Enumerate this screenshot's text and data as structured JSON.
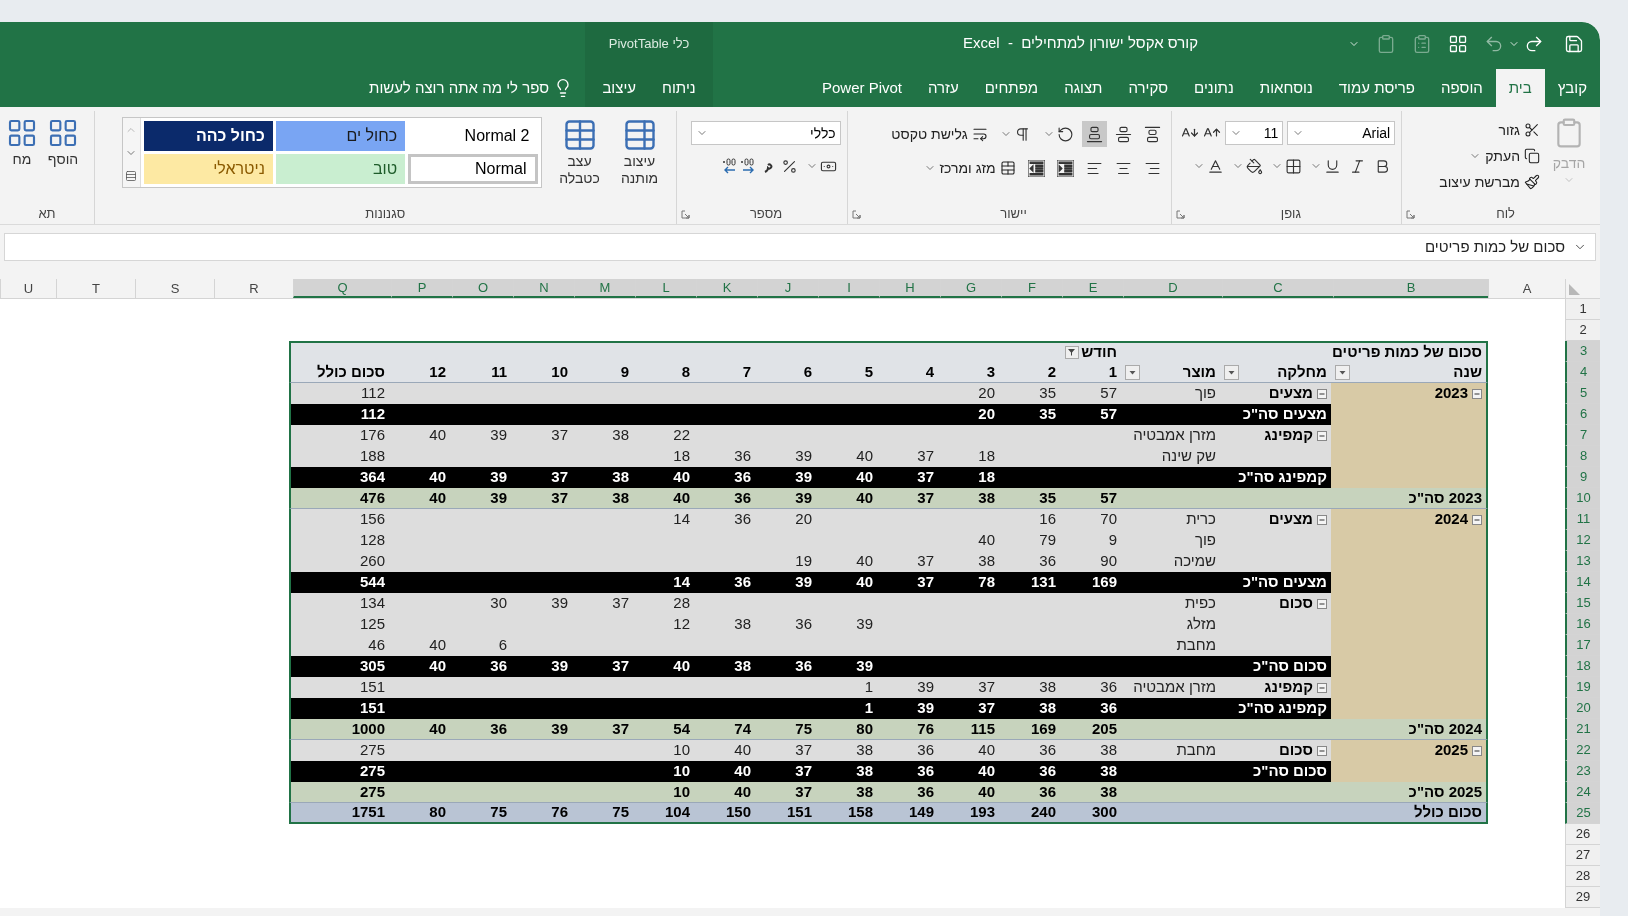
{
  "window": {
    "title": "קורס אקסל ישורון למתחילים  -  Excel"
  },
  "contextual_group": {
    "label": "כלי PivotTable"
  },
  "tabs": [
    {
      "label": "קובץ",
      "kind": "main",
      "selected": false
    },
    {
      "label": "בית",
      "kind": "main",
      "selected": true
    },
    {
      "label": "הוספה",
      "kind": "main",
      "selected": false
    },
    {
      "label": "פריסת עמוד",
      "kind": "main",
      "selected": false
    },
    {
      "label": "נוסחאות",
      "kind": "main",
      "selected": false
    },
    {
      "label": "נתונים",
      "kind": "main",
      "selected": false
    },
    {
      "label": "סקירה",
      "kind": "main",
      "selected": false
    },
    {
      "label": "תצוגה",
      "kind": "main",
      "selected": false
    },
    {
      "label": "מפתחים",
      "kind": "main",
      "selected": false
    },
    {
      "label": "עזרה",
      "kind": "main",
      "selected": false
    },
    {
      "label": "Power Pivot",
      "kind": "main",
      "selected": false
    },
    {
      "label": "ניתוח",
      "kind": "contextual",
      "selected": false
    },
    {
      "label": "עיצוב",
      "kind": "contextual",
      "selected": false
    }
  ],
  "tell_me": {
    "label": "ספר לי מה אתה רוצה לעשות"
  },
  "ribbon": {
    "clipboard": {
      "label": "לוח",
      "paste": {
        "label": "הדבק",
        "disabled": true
      },
      "cut": "גזור",
      "copy": "העתק",
      "format_painter": "מברשת עיצוב"
    },
    "font": {
      "label": "גופן",
      "font_name": "Arial",
      "font_size": "11"
    },
    "alignment": {
      "label": "יישור",
      "wrap_text": "גלישת טקסט",
      "merge": "מזג ומרכז",
      "vertical": [
        {
          "kind": "top",
          "selected": false
        },
        {
          "kind": "middle",
          "selected": false
        },
        {
          "kind": "bottom",
          "selected": true
        }
      ]
    },
    "number": {
      "label": "מספר",
      "format": "כללי"
    },
    "styles": {
      "label": "סגנונות",
      "conditional_formatting": "עיצוב מותנה",
      "format_as_table": "עצב כטבלה",
      "gallery": [
        {
          "label": "Normal 2",
          "kind": "plain",
          "selected": false
        },
        {
          "label": "כחול ים",
          "kind": "accent",
          "selected": false
        },
        {
          "label": "כחול כהה",
          "kind": "dark",
          "selected": false
        },
        {
          "label": "Normal",
          "kind": "plain",
          "selected": true
        },
        {
          "label": "טוב",
          "kind": "good",
          "selected": false
        },
        {
          "label": "ניטראלי",
          "kind": "neutral",
          "selected": false
        }
      ]
    },
    "cells": {
      "label": "תא",
      "insert": "הוסף",
      "delete": "מח"
    }
  },
  "formula_bar": {
    "value": "סכום של כמות פריטים"
  },
  "sheet": {
    "columns": [
      {
        "letter": "A",
        "selected": false
      },
      {
        "letter": "B",
        "selected": true
      },
      {
        "letter": "C",
        "selected": true
      },
      {
        "letter": "D",
        "selected": true
      },
      {
        "letter": "E",
        "selected": true
      },
      {
        "letter": "F",
        "selected": true
      },
      {
        "letter": "G",
        "selected": true
      },
      {
        "letter": "H",
        "selected": true
      },
      {
        "letter": "I",
        "selected": true
      },
      {
        "letter": "J",
        "selected": true
      },
      {
        "letter": "K",
        "selected": true
      },
      {
        "letter": "L",
        "selected": true
      },
      {
        "letter": "M",
        "selected": true
      },
      {
        "letter": "N",
        "selected": true
      },
      {
        "letter": "O",
        "selected": true
      },
      {
        "letter": "P",
        "selected": true
      },
      {
        "letter": "Q",
        "selected": true
      },
      {
        "letter": "R",
        "selected": false
      },
      {
        "letter": "S",
        "selected": false
      },
      {
        "letter": "T",
        "selected": false
      },
      {
        "letter": "U",
        "selected": false
      }
    ],
    "rows": [
      {
        "number": "1",
        "selected": false
      },
      {
        "number": "2",
        "selected": false
      },
      {
        "number": "3",
        "selected": true,
        "kind": "header_title",
        "title": "סכום של כמות פריטים",
        "column_field": {
          "text": "חודש",
          "filtered": true
        }
      },
      {
        "number": "4",
        "selected": true,
        "kind": "header",
        "year": {
          "text": "שנה",
          "dropdown": true
        },
        "category": {
          "text": "מחלקה",
          "dropdown": true
        },
        "product": {
          "text": "מוצר",
          "dropdown": true
        },
        "values": {
          "m1": "1",
          "m2": "2",
          "m3": "3",
          "m4": "4",
          "m5": "5",
          "m6": "6",
          "m7": "7",
          "m8": "8",
          "m9": "9",
          "m10": "10",
          "m11": "11",
          "m12": "12"
        },
        "total": "סכום כולל"
      },
      {
        "number": "5",
        "selected": true,
        "kind": "data",
        "year": {
          "text": "2023",
          "expanded": true
        },
        "category": {
          "text": "מצעים",
          "expanded": true
        },
        "product": "פוך",
        "values": {
          "m1": "57",
          "m2": "35",
          "m3": "20"
        },
        "total": "112"
      },
      {
        "number": "6",
        "selected": true,
        "kind": "subtotal",
        "label": "מצעים סה\"כ",
        "values": {
          "m1": "57",
          "m2": "35",
          "m3": "20"
        },
        "total": "112"
      },
      {
        "number": "7",
        "selected": true,
        "kind": "data",
        "category": {
          "text": "קמפינג",
          "expanded": true
        },
        "product": "מזרן אמבטיה",
        "values": {
          "m8": "22",
          "m9": "38",
          "m10": "37",
          "m11": "39",
          "m12": "40"
        },
        "total": "176"
      },
      {
        "number": "8",
        "selected": true,
        "kind": "data",
        "product": "שק שינה",
        "values": {
          "m3": "18",
          "m4": "37",
          "m5": "40",
          "m6": "39",
          "m7": "36",
          "m8": "18"
        },
        "total": "188"
      },
      {
        "number": "9",
        "selected": true,
        "kind": "subtotal",
        "label": "קמפינג סה\"כ",
        "values": {
          "m3": "18",
          "m4": "37",
          "m5": "40",
          "m6": "39",
          "m7": "36",
          "m8": "40",
          "m9": "38",
          "m10": "37",
          "m11": "39",
          "m12": "40"
        },
        "total": "364"
      },
      {
        "number": "10",
        "selected": true,
        "kind": "year_total",
        "label": "2023 סה\"כ",
        "values": {
          "m1": "57",
          "m2": "35",
          "m3": "38",
          "m4": "37",
          "m5": "40",
          "m6": "39",
          "m7": "36",
          "m8": "40",
          "m9": "38",
          "m10": "37",
          "m11": "39",
          "m12": "40"
        },
        "total": "476"
      },
      {
        "number": "11",
        "selected": true,
        "kind": "data",
        "year": {
          "text": "2024",
          "expanded": true
        },
        "category": {
          "text": "מצעים",
          "expanded": true
        },
        "product": "כרית",
        "values": {
          "m1": "70",
          "m2": "16",
          "m6": "20",
          "m7": "36",
          "m8": "14"
        },
        "total": "156"
      },
      {
        "number": "12",
        "selected": true,
        "kind": "data",
        "product": "פוך",
        "values": {
          "m1": "9",
          "m2": "79",
          "m3": "40"
        },
        "total": "128"
      },
      {
        "number": "13",
        "selected": true,
        "kind": "data",
        "product": "שמיכה",
        "values": {
          "m1": "90",
          "m2": "36",
          "m3": "38",
          "m4": "37",
          "m5": "40",
          "m6": "19"
        },
        "total": "260"
      },
      {
        "number": "14",
        "selected": true,
        "kind": "subtotal",
        "label": "מצעים סה\"כ",
        "values": {
          "m1": "169",
          "m2": "131",
          "m3": "78",
          "m4": "37",
          "m5": "40",
          "m6": "39",
          "m7": "36",
          "m8": "14"
        },
        "total": "544"
      },
      {
        "number": "15",
        "selected": true,
        "kind": "data",
        "category": {
          "text": "סכום",
          "expanded": true
        },
        "product": "כפית",
        "values": {
          "m8": "28",
          "m9": "37",
          "m10": "39",
          "m11": "30"
        },
        "total": "134"
      },
      {
        "number": "16",
        "selected": true,
        "kind": "data",
        "product": "מזלג",
        "values": {
          "m5": "39",
          "m6": "36",
          "m7": "38",
          "m8": "12"
        },
        "total": "125"
      },
      {
        "number": "17",
        "selected": true,
        "kind": "data",
        "product": "מחבת",
        "values": {
          "m11": "6",
          "m12": "40"
        },
        "total": "46"
      },
      {
        "number": "18",
        "selected": true,
        "kind": "subtotal",
        "label": "סכום סה\"כ",
        "values": {
          "m5": "39",
          "m6": "36",
          "m7": "38",
          "m8": "40",
          "m9": "37",
          "m10": "39",
          "m11": "36",
          "m12": "40"
        },
        "total": "305"
      },
      {
        "number": "19",
        "selected": true,
        "kind": "data",
        "category": {
          "text": "קמפינג",
          "expanded": true
        },
        "product": "מזרן אמבטיה",
        "values": {
          "m1": "36",
          "m2": "38",
          "m3": "37",
          "m4": "39",
          "m5": "1"
        },
        "total": "151"
      },
      {
        "number": "20",
        "selected": true,
        "kind": "subtotal",
        "label": "קמפינג סה\"כ",
        "values": {
          "m1": "36",
          "m2": "38",
          "m3": "37",
          "m4": "39",
          "m5": "1"
        },
        "total": "151"
      },
      {
        "number": "21",
        "selected": true,
        "kind": "year_total",
        "label": "2024 סה\"כ",
        "values": {
          "m1": "205",
          "m2": "169",
          "m3": "115",
          "m4": "76",
          "m5": "80",
          "m6": "75",
          "m7": "74",
          "m8": "54",
          "m9": "37",
          "m10": "39",
          "m11": "36",
          "m12": "40"
        },
        "total": "1000"
      },
      {
        "number": "22",
        "selected": true,
        "kind": "data",
        "year": {
          "text": "2025",
          "expanded": true
        },
        "category": {
          "text": "סכום",
          "expanded": true
        },
        "product": "מחבת",
        "values": {
          "m1": "38",
          "m2": "36",
          "m3": "40",
          "m4": "36",
          "m5": "38",
          "m6": "37",
          "m7": "40",
          "m8": "10"
        },
        "total": "275"
      },
      {
        "number": "23",
        "selected": true,
        "kind": "subtotal",
        "label": "סכום סה\"כ",
        "values": {
          "m1": "38",
          "m2": "36",
          "m3": "40",
          "m4": "36",
          "m5": "38",
          "m6": "37",
          "m7": "40",
          "m8": "10"
        },
        "total": "275"
      },
      {
        "number": "24",
        "selected": true,
        "kind": "year_total",
        "label": "2025 סה\"כ",
        "values": {
          "m1": "38",
          "m2": "36",
          "m3": "40",
          "m4": "36",
          "m5": "38",
          "m6": "37",
          "m7": "40",
          "m8": "10"
        },
        "total": "275"
      },
      {
        "number": "25",
        "selected": true,
        "kind": "grand_total",
        "label": "סכום כולל",
        "values": {
          "m1": "300",
          "m2": "240",
          "m3": "193",
          "m4": "149",
          "m5": "158",
          "m6": "151",
          "m7": "150",
          "m8": "104",
          "m9": "75",
          "m10": "76",
          "m11": "75",
          "m12": "80"
        },
        "total": "1751"
      },
      {
        "number": "26",
        "selected": false
      },
      {
        "number": "27",
        "selected": false
      },
      {
        "number": "28",
        "selected": false
      },
      {
        "number": "29",
        "selected": false
      }
    ]
  }
}
